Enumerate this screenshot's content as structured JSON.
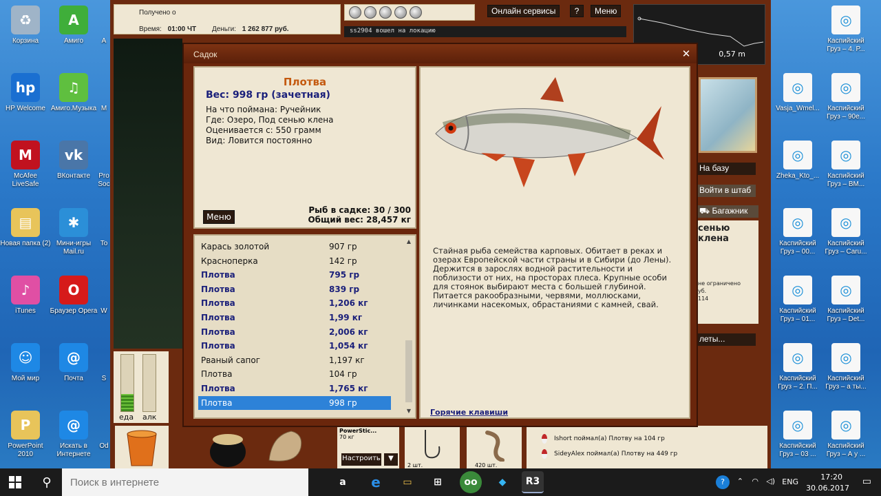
{
  "desktop": {
    "icons_left": [
      {
        "label": "Корзина",
        "color": "#9fb4c8",
        "glyph": "♻"
      },
      {
        "label": "Амиго",
        "color": "#3fae3a",
        "glyph": "A"
      },
      {
        "label": "HP Welcome",
        "color": "#1a6fd1",
        "glyph": "hp"
      },
      {
        "label": "Амиго.Музыка",
        "color": "#5fbf3f",
        "glyph": "♫"
      },
      {
        "label": "McAfee LiveSafe",
        "color": "#c1121f",
        "glyph": "M"
      },
      {
        "label": "ВКонтакте",
        "color": "#4a76a8",
        "glyph": "vk"
      },
      {
        "label": "Новая папка (2)",
        "color": "#e8c45a",
        "glyph": "▤"
      },
      {
        "label": "Мини-игры Mail.ru",
        "color": "#2b8fd8",
        "glyph": "✱"
      },
      {
        "label": "iTunes",
        "color": "#e04fa4",
        "glyph": "♪"
      },
      {
        "label": "Браузер Opera",
        "color": "#d61a1a",
        "glyph": "O"
      },
      {
        "label": "Мой мир",
        "color": "#1e88e5",
        "glyph": "☺"
      },
      {
        "label": "Почта",
        "color": "#1e88e5",
        "glyph": "@"
      },
      {
        "label": "PowerPoint 2010",
        "color": "#e8c45a",
        "glyph": "P"
      },
      {
        "label": "Искать в Интернете",
        "color": "#1e88e5",
        "glyph": "@"
      }
    ],
    "icons_cut": [
      "A",
      "M",
      "Pro Soc",
      "To",
      "W",
      "S",
      "Od"
    ],
    "icons_right": [
      {
        "label": "Каспийский Груз – 4. Р..."
      },
      {
        "label": "Vasja_Wmel..."
      },
      {
        "label": "Каспийский Груз – 90е..."
      },
      {
        "label": "Zheka_Kto_..."
      },
      {
        "label": "Каспийский Груз – ВМ..."
      },
      {
        "label": "Каспийский Груз – 00..."
      },
      {
        "label": "Каспийский Груз – Caru..."
      },
      {
        "label": "Каспийский Груз – 01..."
      },
      {
        "label": "Каспийский Груз – Det..."
      },
      {
        "label": "Каспийский Груз – 2. П..."
      },
      {
        "label": "Каспийский Груз – а ты..."
      },
      {
        "label": "Каспийский Груз – 03 ..."
      },
      {
        "label": "Каспийский Груз – А у ..."
      }
    ]
  },
  "game": {
    "info": {
      "received": "Получено о",
      "time_label": "Время:",
      "time_value": "01:00 ЧТ",
      "money_label": "Деньги:",
      "money_value": "1 262 877 руб."
    },
    "online_services": "Онлайн сервисы",
    "help": "?",
    "menu": "Меню",
    "chat_line": "ss2904 вошел на локацию",
    "depth": "0,57 m",
    "right_panel": {
      "to_base": "На базу",
      "to_hq": "Войти в штаб",
      "trunk": "Багажник",
      "location": "сенью клена",
      "small1": "не ограничено",
      "small2": "уб.",
      "small3": "114",
      "more": "леты..."
    },
    "gauges": [
      {
        "label": "еда",
        "level": 0.3
      },
      {
        "label": "алк",
        "level": 0
      }
    ],
    "reel": {
      "name": "PowerStic...",
      "weight": "70 кг"
    },
    "setup": "Настроить",
    "setup_arrow": "▼",
    "tackle": [
      {
        "count": "2 шт."
      },
      {
        "count": "420 шт."
      }
    ],
    "log": [
      "Ishort поймал(а) Плотву на 104 гр",
      "SideyAlex поймал(а) Плотву на 449 гр"
    ]
  },
  "dialog": {
    "title": "Садок",
    "close": "✕",
    "fish_name": "Плотва",
    "fish_weight": "Вес: 998 гр (зачетная)",
    "details": [
      "На что поймана: Ручейник",
      "Где: Озеро, Под сенью клена",
      "Оценивается с: 550 грамм",
      "Вид: Ловится постоянно"
    ],
    "menu_button": "Меню",
    "fish_count": "Рыб в садке: 30 / 300",
    "total_weight": "Общий вес: 28,457 кг",
    "list": [
      {
        "name": "Карась золотой",
        "weight": "907 гр",
        "style": "plain"
      },
      {
        "name": "Красноперка",
        "weight": "142 гр",
        "style": "plain"
      },
      {
        "name": "Плотва",
        "weight": "795 гр",
        "style": "bold"
      },
      {
        "name": "Плотва",
        "weight": "839 гр",
        "style": "bold"
      },
      {
        "name": "Плотва",
        "weight": "1,206 кг",
        "style": "bold"
      },
      {
        "name": "Плотва",
        "weight": "1,99 кг",
        "style": "bold"
      },
      {
        "name": "Плотва",
        "weight": "2,006 кг",
        "style": "bold"
      },
      {
        "name": "Плотва",
        "weight": "1,054 кг",
        "style": "bold"
      },
      {
        "name": "Рваный сапог",
        "weight": "1,197 кг",
        "style": "plain"
      },
      {
        "name": "Плотва",
        "weight": "104 гр",
        "style": "plain"
      },
      {
        "name": "Плотва",
        "weight": "1,765 кг",
        "style": "bold"
      },
      {
        "name": "Плотва",
        "weight": "998 гр",
        "style": "sel"
      }
    ],
    "description": "Стайная рыба семейства карповых. Обитает в реках и озерах Европейской части страны и в Сибири (до Лены). Держится в зарослях водной растительности и поблизости от них, на просторах плеса. Крупные особи для стоянок выбирают места с большей глубиной. Питается ракообразными, червями, моллюсками, личинками насекомых, обрастаниями с камней, свай.",
    "hotkeys": "Горячие клавиши"
  },
  "taskbar": {
    "search_placeholder": "Поиск в интернете",
    "language": "ENG",
    "time": "17:20",
    "date": "30.06.2017"
  }
}
